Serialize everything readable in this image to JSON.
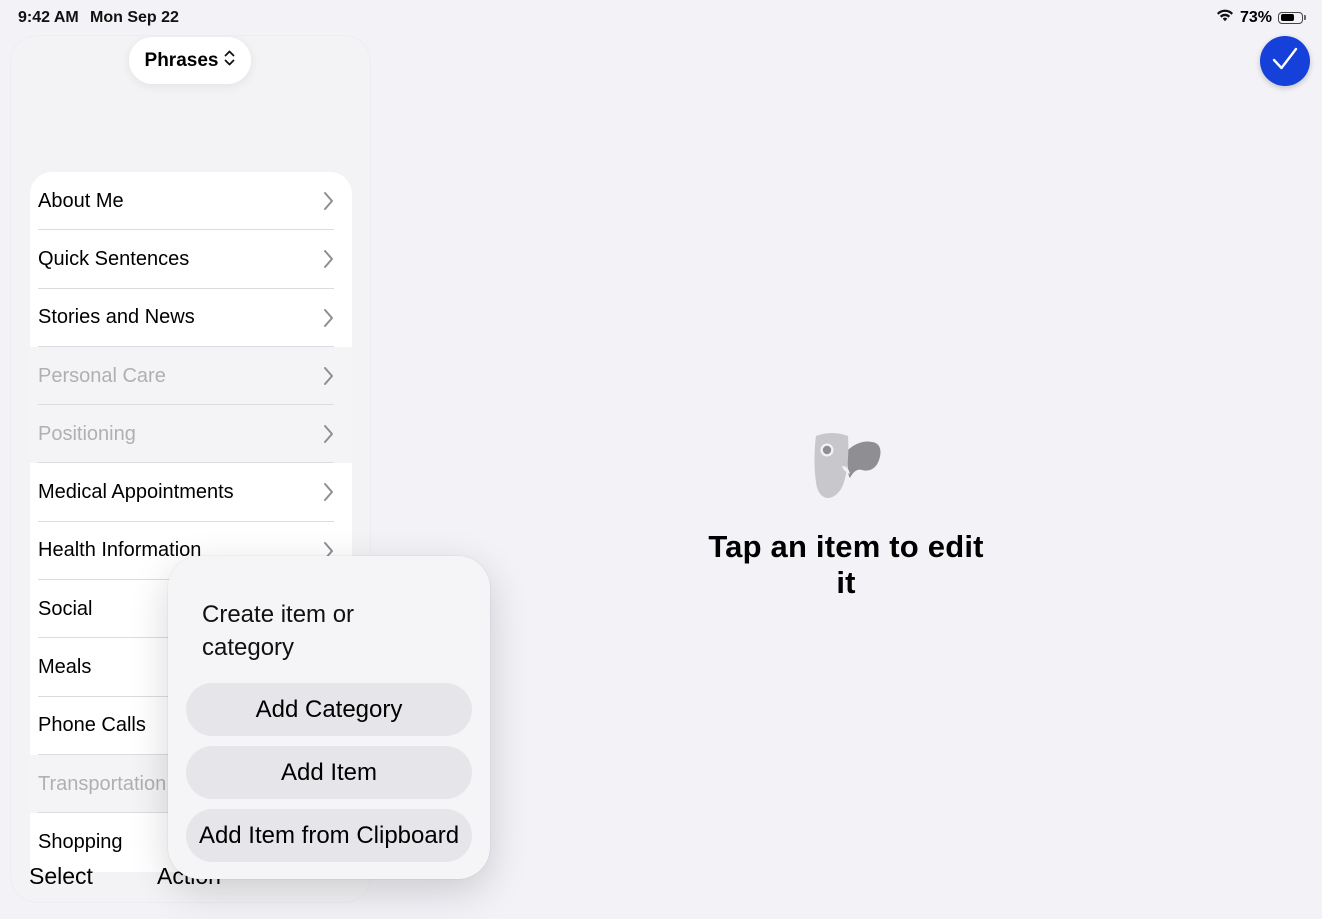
{
  "status_bar": {
    "time": "9:42 AM",
    "date": "Mon Sep 22",
    "battery": "73%",
    "battery_level": 0.73
  },
  "header": {
    "title": "Phrases",
    "title_icon": "chevron-up-down-icon",
    "done_icon": "checkmark-icon"
  },
  "sidebar": {
    "items": [
      {
        "label": "About Me",
        "disabled": false
      },
      {
        "label": "Quick Sentences",
        "disabled": false
      },
      {
        "label": "Stories and News",
        "disabled": false
      },
      {
        "label": "Personal Care",
        "disabled": true
      },
      {
        "label": "Positioning",
        "disabled": true
      },
      {
        "label": "Medical Appointments",
        "disabled": false
      },
      {
        "label": "Health Information",
        "disabled": false
      },
      {
        "label": "Social",
        "disabled": false
      },
      {
        "label": "Meals",
        "disabled": false
      },
      {
        "label": "Phone Calls",
        "disabled": false
      },
      {
        "label": "Transportation",
        "disabled": true
      },
      {
        "label": "Shopping",
        "disabled": false
      }
    ]
  },
  "toolbar": {
    "select_label": "Select",
    "action_label": "Action"
  },
  "detail": {
    "placeholder": "Tap an item to edit it",
    "icon": "theater-masks-icon"
  },
  "popover": {
    "title": "Create item or category",
    "buttons": [
      "Add Category",
      "Add Item",
      "Add Item from Clipboard"
    ]
  },
  "colors": {
    "accent": "#1540d9",
    "background": "#f2f2f7",
    "disabled_text": "#b0b0b4"
  }
}
